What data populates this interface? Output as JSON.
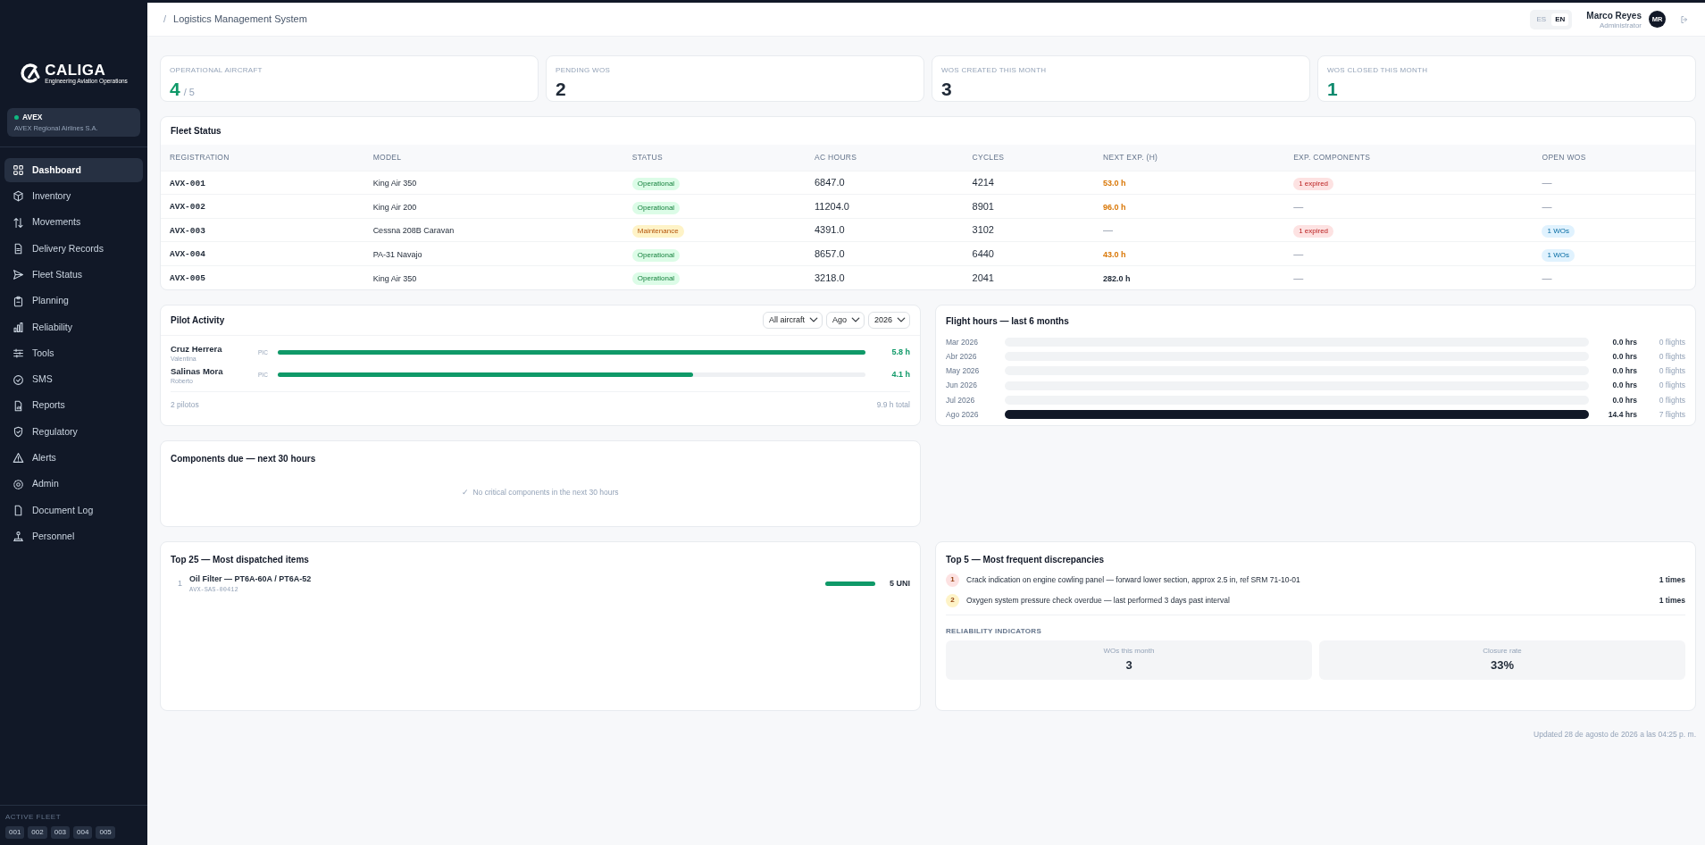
{
  "sidebar": {
    "logo_text": "CALIGA",
    "logo_tagline": "Engineering Aviation Operations",
    "org": {
      "code": "AVEX",
      "name": "AVEX Regional Airlines S.A.",
      "active": true
    },
    "items": [
      {
        "label": "Dashboard",
        "selected": true
      },
      {
        "label": "Inventory",
        "selected": false
      },
      {
        "label": "Movements",
        "selected": false
      },
      {
        "label": "Delivery Records",
        "selected": false
      },
      {
        "label": "Fleet Status",
        "selected": false
      },
      {
        "label": "Planning",
        "selected": false
      },
      {
        "label": "Reliability",
        "selected": false
      },
      {
        "label": "Tools",
        "selected": false
      },
      {
        "label": "SMS",
        "selected": false
      },
      {
        "label": "Reports",
        "selected": false
      },
      {
        "label": "Regulatory",
        "selected": false
      },
      {
        "label": "Alerts",
        "selected": false
      },
      {
        "label": "Admin",
        "selected": false
      },
      {
        "label": "Document Log",
        "selected": false
      },
      {
        "label": "Personnel",
        "selected": false
      }
    ],
    "active_fleet": {
      "title": "ACTIVE FLEET",
      "tags": [
        "001",
        "002",
        "003",
        "004",
        "005"
      ]
    }
  },
  "header": {
    "breadcrumb_sep": "/",
    "title": "Logistics Management System",
    "languages": [
      {
        "label": "ES",
        "selected": false
      },
      {
        "label": "EN",
        "selected": true
      }
    ],
    "user": {
      "name": "Marco Reyes",
      "role": "Administrator",
      "initials": "MR"
    }
  },
  "kpis": [
    {
      "label": "OPERATIONAL AIRCRAFT",
      "value": "4",
      "suffix": "/ 5",
      "kind": "good"
    },
    {
      "label": "PENDING WOS",
      "value": "2",
      "kind": "plain"
    },
    {
      "label": "WOS CREATED THIS MONTH",
      "value": "3",
      "kind": "plain"
    },
    {
      "label": "WOS CLOSED THIS MONTH",
      "value": "1",
      "kind": "teal"
    }
  ],
  "fleet": {
    "title": "Fleet Status",
    "columns": [
      "REGISTRATION",
      "MODEL",
      "STATUS",
      "AC HOURS",
      "CYCLES",
      "NEXT EXP. (H)",
      "EXP. COMPONENTS",
      "OPEN WOS"
    ],
    "rows": [
      {
        "registration": "AVX-001",
        "model": "King Air 350",
        "status": {
          "text": "Operational",
          "kind": "ok"
        },
        "ac_hours": "6847.0",
        "cycles": "4214",
        "next_exp": {
          "text": "53.0 h",
          "kind": "warn"
        },
        "exp_components": {
          "text": "1 expired",
          "kind": "badge"
        },
        "open_wos": {
          "text": "—",
          "kind": "none"
        }
      },
      {
        "registration": "AVX-002",
        "model": "King Air 200",
        "status": {
          "text": "Operational",
          "kind": "ok"
        },
        "ac_hours": "11204.0",
        "cycles": "8901",
        "next_exp": {
          "text": "96.0 h",
          "kind": "warn"
        },
        "exp_components": {
          "text": "—",
          "kind": "none"
        },
        "open_wos": {
          "text": "—",
          "kind": "none"
        }
      },
      {
        "registration": "AVX-003",
        "model": "Cessna 208B Caravan",
        "status": {
          "text": "Maintenance",
          "kind": "maint"
        },
        "ac_hours": "4391.0",
        "cycles": "3102",
        "next_exp": {
          "text": "—",
          "kind": "none"
        },
        "exp_components": {
          "text": "1 expired",
          "kind": "badge"
        },
        "open_wos": {
          "text": "1 WOs",
          "kind": "badge"
        }
      },
      {
        "registration": "AVX-004",
        "model": "PA-31 Navajo",
        "status": {
          "text": "Operational",
          "kind": "ok"
        },
        "ac_hours": "8657.0",
        "cycles": "6440",
        "next_exp": {
          "text": "43.0 h",
          "kind": "warn"
        },
        "exp_components": {
          "text": "—",
          "kind": "none"
        },
        "open_wos": {
          "text": "1 WOs",
          "kind": "badge"
        }
      },
      {
        "registration": "AVX-005",
        "model": "King Air 350",
        "status": {
          "text": "Operational",
          "kind": "ok"
        },
        "ac_hours": "3218.0",
        "cycles": "2041",
        "next_exp": {
          "text": "282.0 h",
          "kind": "normal"
        },
        "exp_components": {
          "text": "—",
          "kind": "none"
        },
        "open_wos": {
          "text": "—",
          "kind": "none"
        }
      }
    ]
  },
  "pilot_activity": {
    "title": "Pilot Activity",
    "filters": [
      {
        "value": "All aircraft"
      },
      {
        "value": "Ago"
      },
      {
        "value": "2026"
      }
    ],
    "pilots": [
      {
        "name": "Cruz Herrera",
        "first_name": "Valentina",
        "role": "PIC",
        "level": 1.0,
        "hours": "5.8 h"
      },
      {
        "name": "Salinas Mora",
        "first_name": "Roberto",
        "role": "PIC",
        "level": 0.707,
        "hours": "4.1 h"
      }
    ],
    "count": "2 pilotos",
    "total": "9.9 h total"
  },
  "flight_hours": {
    "title": "Flight hours — last 6 months",
    "months": [
      {
        "month": "Mar 2026",
        "level": 0,
        "hours": "0.0 hrs",
        "flights": "0 flights"
      },
      {
        "month": "Abr 2026",
        "level": 0,
        "hours": "0.0 hrs",
        "flights": "0 flights"
      },
      {
        "month": "May 2026",
        "level": 0,
        "hours": "0.0 hrs",
        "flights": "0 flights"
      },
      {
        "month": "Jun 2026",
        "level": 0,
        "hours": "0.0 hrs",
        "flights": "0 flights"
      },
      {
        "month": "Jul 2026",
        "level": 0,
        "hours": "0.0 hrs",
        "flights": "0 flights"
      },
      {
        "month": "Ago 2026",
        "level": 1.0,
        "hours": "14.4 hrs",
        "flights": "7 flights"
      }
    ]
  },
  "components_due": {
    "title": "Components due — next 30 hours",
    "empty_mark": "✓",
    "empty_text": "No critical components in the next 30 hours"
  },
  "top_items": {
    "title": "Top 25 — Most dispatched items",
    "items": [
      {
        "rank": "1",
        "name": "Oil Filter — PT6A-60A / PT6A-52",
        "code": "AVX-SAS-00412",
        "level": 1.0,
        "qty": "5 UNI"
      }
    ]
  },
  "discrepancies": {
    "title": "Top 5 — Most frequent discrepancies",
    "items": [
      {
        "rank": "1",
        "text": "Crack indication on engine cowling panel — forward lower section, approx 2.5 in, ref SRM 71-10-01",
        "count": "1 times",
        "color": "#fde2e2"
      },
      {
        "rank": "2",
        "text": "Oxygen system pressure check overdue — last performed 3 days past interval",
        "count": "1 times",
        "color": "#fef3c7"
      }
    ],
    "indicators_title": "RELIABILITY INDICATORS",
    "indicators": [
      {
        "label": "WOs this month",
        "value": "3"
      },
      {
        "label": "Closure rate",
        "value": "33%"
      }
    ]
  },
  "updated": "Updated 28 de agosto de 2026 a las 04:25 p. m."
}
